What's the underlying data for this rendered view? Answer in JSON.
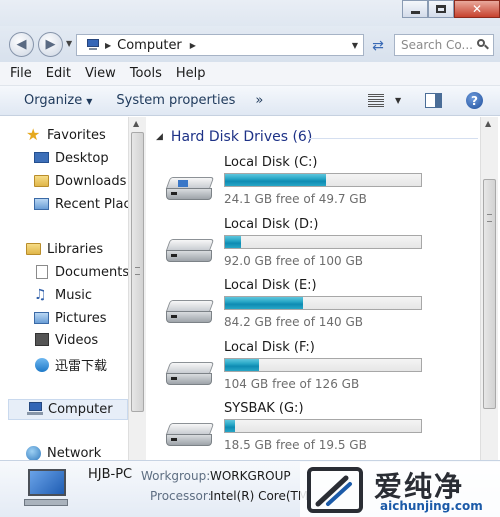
{
  "window": {
    "caption_buttons": [
      "minimize",
      "maximize",
      "close"
    ]
  },
  "address_bar": {
    "location": "Computer",
    "search_placeholder": "Search Co..."
  },
  "menu": [
    "File",
    "Edit",
    "View",
    "Tools",
    "Help"
  ],
  "command_bar": {
    "organize": "Organize",
    "system_properties": "System properties",
    "more": "»"
  },
  "nav_pane": {
    "favorites": {
      "label": "Favorites",
      "items": [
        "Desktop",
        "Downloads",
        "Recent Place"
      ]
    },
    "libraries": {
      "label": "Libraries",
      "items": [
        "Documents",
        "Music",
        "Pictures",
        "Videos",
        "迅雷下载"
      ]
    },
    "computer": "Computer",
    "network": "Network"
  },
  "content": {
    "section_title": "Hard Disk Drives (6)",
    "drives": [
      {
        "name": "Local Disk (C:)",
        "free_text": "24.1 GB free of 49.7 GB",
        "used_fraction": 0.515
      },
      {
        "name": "Local Disk (D:)",
        "free_text": "92.0 GB free of 100 GB",
        "used_fraction": 0.08
      },
      {
        "name": "Local Disk (E:)",
        "free_text": "84.2 GB free of 140 GB",
        "used_fraction": 0.4
      },
      {
        "name": "Local Disk (F:)",
        "free_text": "104 GB free of 126 GB",
        "used_fraction": 0.175
      },
      {
        "name": "SYSBAK (G:)",
        "free_text": "18.5 GB free of 19.5 GB",
        "used_fraction": 0.05
      }
    ]
  },
  "details": {
    "pc_name": "HJB-PC",
    "workgroup_label": "Workgroup:",
    "workgroup_value": "WORKGROUP",
    "processor_label": "Processor:",
    "processor_value": "Intel(R) Core(TM"
  },
  "watermark": {
    "brand_cn": "爱纯净",
    "url": "aichunjing.com"
  }
}
